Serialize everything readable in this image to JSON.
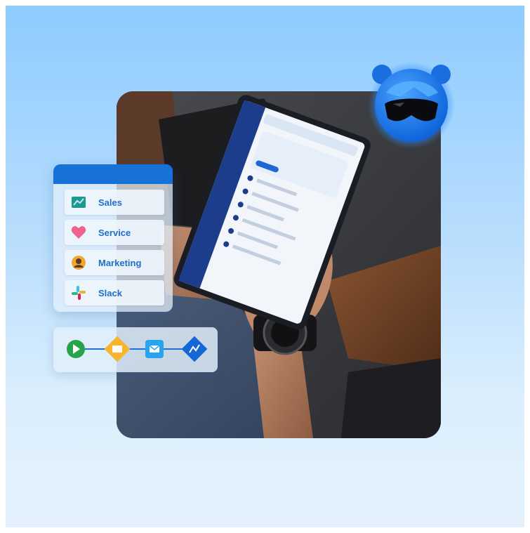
{
  "apps": [
    {
      "label": "Sales",
      "icon": "sales-chart-icon"
    },
    {
      "label": "Service",
      "icon": "heart-icon"
    },
    {
      "label": "Marketing",
      "icon": "marketing-person-icon"
    },
    {
      "label": "Slack",
      "icon": "slack-icon"
    }
  ],
  "flow": [
    "play-icon",
    "contact-card-icon",
    "email-icon",
    "analytics-icon"
  ],
  "colors": {
    "accent": "#1772d8",
    "label": "#1f6ec8",
    "background_top": "#8ecbff",
    "background_bottom": "#e4f1fc"
  }
}
